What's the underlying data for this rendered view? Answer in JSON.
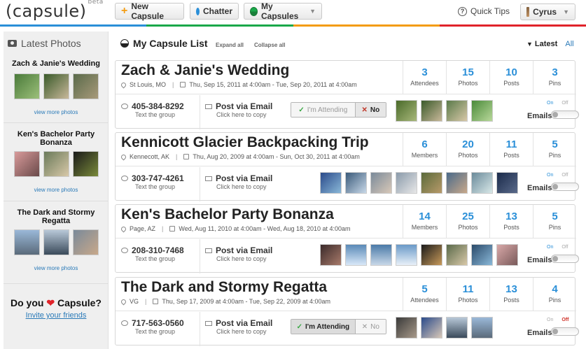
{
  "app": {
    "logo": "(capsule)",
    "beta": "beta"
  },
  "topbar": {
    "new_capsule": "New Capsule",
    "chatter": "Chatter",
    "my_capsules": "My Capsules",
    "quick_tips": "Quick Tips",
    "user": "Cyrus"
  },
  "colors": {
    "stripes": [
      "#2a8fd8",
      "#1aa84a",
      "#f39c12",
      "#e0232a"
    ]
  },
  "sidebar": {
    "heading": "Latest Photos",
    "sections": [
      {
        "title": "Zach & Janie's Wedding",
        "more": "view more photos"
      },
      {
        "title": "Ken's Bachelor Party Bonanza",
        "more": "view more photos"
      },
      {
        "title": "The Dark and Stormy Regatta",
        "more": "view more photos"
      }
    ],
    "do_you": "Do you",
    "capsule_q": "Capsule?",
    "invite": "Invite your friends"
  },
  "list": {
    "title": "My Capsule List",
    "expand": "Expand all",
    "collapse": "Collapse all",
    "sort_latest": "Latest",
    "sort_all": "All"
  },
  "common": {
    "text_group": "Text the group",
    "post_email": "Post via Email",
    "click_copy": "Click here to copy",
    "attending": "I'm Attending",
    "no": "No",
    "emails": "Emails",
    "on": "On",
    "off": "Off"
  },
  "capsules": [
    {
      "title": "Zach & Janie's Wedding",
      "location": "St Louis, MO",
      "dates": "Thu, Sep 15, 2011 at 4:00am - Tue, Sep 20, 2011 at 4:00am",
      "stats": [
        {
          "num": "3",
          "label": "Attendees"
        },
        {
          "num": "15",
          "label": "Photos"
        },
        {
          "num": "10",
          "label": "Posts"
        },
        {
          "num": "3",
          "label": "Pins"
        }
      ],
      "phone": "405-384-8292"
    },
    {
      "title": "Kennicott Glacier Backpacking Trip",
      "location": "Kennecott, AK",
      "dates": "Thu, Aug 20, 2009 at 4:00am - Sun, Oct 30, 2011 at 4:00am",
      "stats": [
        {
          "num": "6",
          "label": "Members"
        },
        {
          "num": "20",
          "label": "Photos"
        },
        {
          "num": "11",
          "label": "Posts"
        },
        {
          "num": "5",
          "label": "Pins"
        }
      ],
      "phone": "303-747-4261"
    },
    {
      "title": "Ken's Bachelor Party Bonanza",
      "location": "Page, AZ",
      "dates": "Wed, Aug 11, 2010 at 4:00am - Wed, Aug 18, 2010 at 4:00am",
      "stats": [
        {
          "num": "14",
          "label": "Members"
        },
        {
          "num": "25",
          "label": "Photos"
        },
        {
          "num": "13",
          "label": "Posts"
        },
        {
          "num": "5",
          "label": "Pins"
        }
      ],
      "phone": "208-310-7468"
    },
    {
      "title": "The Dark and Stormy Regatta",
      "location": "VG",
      "dates": "Thu, Sep 17, 2009 at 4:00am - Tue, Sep 22, 2009 at 4:00am",
      "stats": [
        {
          "num": "5",
          "label": "Attendees"
        },
        {
          "num": "11",
          "label": "Photos"
        },
        {
          "num": "13",
          "label": "Posts"
        },
        {
          "num": "4",
          "label": "Pins"
        }
      ],
      "phone": "717-563-0560"
    }
  ]
}
